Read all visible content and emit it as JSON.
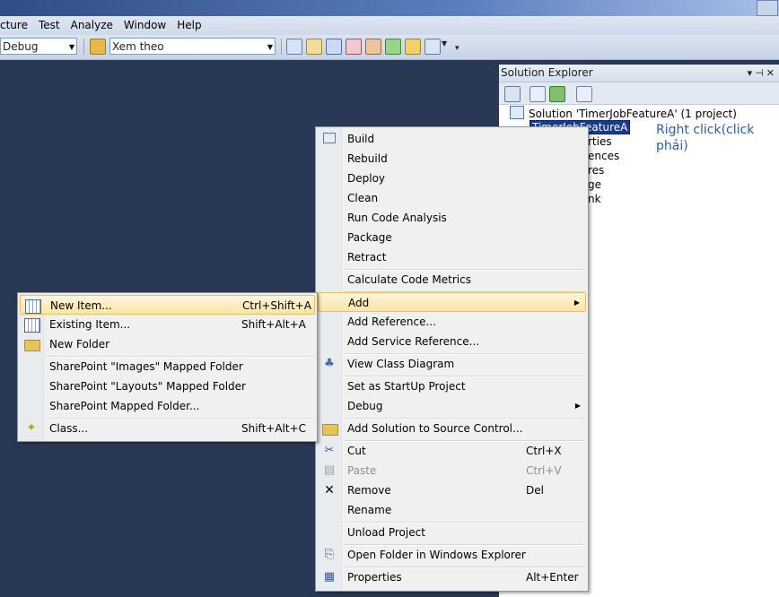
{
  "menubar": {
    "items": [
      "cture",
      "Test",
      "Analyze",
      "Window",
      "Help"
    ]
  },
  "toolbar": {
    "config_value": "Debug",
    "search_value": "Xem theo"
  },
  "solution_explorer": {
    "title": "Solution Explorer",
    "tree": {
      "solution": "Solution 'TimerJobFeatureA' (1 project)",
      "project": "TimerJobFeatureA",
      "children": [
        "rties",
        "ences",
        "res",
        "ge",
        "nk"
      ]
    }
  },
  "annotation": "Right click(click phải)",
  "context_menu": {
    "items": [
      {
        "label": "Build"
      },
      {
        "label": "Rebuild"
      },
      {
        "label": "Deploy"
      },
      {
        "label": "Clean"
      },
      {
        "label": "Run Code Analysis"
      },
      {
        "label": "Package"
      },
      {
        "label": "Retract"
      },
      {
        "label": "Calculate Code Metrics"
      },
      {
        "label": "Add"
      },
      {
        "label": "Add Reference..."
      },
      {
        "label": "Add Service Reference..."
      },
      {
        "label": "View Class Diagram"
      },
      {
        "label": "Set as StartUp Project"
      },
      {
        "label": "Debug"
      },
      {
        "label": "Add Solution to Source Control..."
      },
      {
        "label": "Cut",
        "shortcut": "Ctrl+X"
      },
      {
        "label": "Paste",
        "shortcut": "Ctrl+V"
      },
      {
        "label": "Remove",
        "shortcut": "Del"
      },
      {
        "label": "Rename"
      },
      {
        "label": "Unload Project"
      },
      {
        "label": "Open Folder in Windows Explorer"
      },
      {
        "label": "Properties",
        "shortcut": "Alt+Enter"
      }
    ]
  },
  "add_submenu": {
    "items": [
      {
        "label": "New Item...",
        "shortcut": "Ctrl+Shift+A"
      },
      {
        "label": "Existing Item...",
        "shortcut": "Shift+Alt+A"
      },
      {
        "label": "New Folder"
      },
      {
        "label": "SharePoint \"Images\" Mapped Folder"
      },
      {
        "label": "SharePoint \"Layouts\" Mapped Folder"
      },
      {
        "label": "SharePoint Mapped Folder..."
      },
      {
        "label": "Class...",
        "shortcut": "Shift+Alt+C"
      }
    ]
  }
}
